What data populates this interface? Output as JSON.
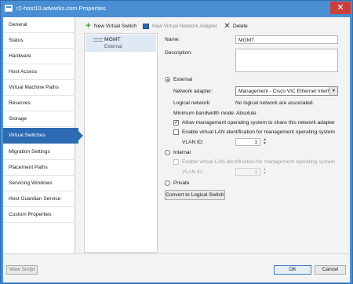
{
  "window": {
    "title": "r2-host10.advwrks.com Properties",
    "close_glyph": "✕"
  },
  "nav": {
    "items": [
      {
        "label": "General"
      },
      {
        "label": "Status"
      },
      {
        "label": "Hardware"
      },
      {
        "label": "Host Access"
      },
      {
        "label": "Virtual Machine Paths"
      },
      {
        "label": "Reserves"
      },
      {
        "label": "Storage"
      },
      {
        "label": "Virtual Switches",
        "selected": true
      },
      {
        "label": "Migration Settings"
      },
      {
        "label": "Placement Paths"
      },
      {
        "label": "Servicing Windows"
      },
      {
        "label": "Host Guardian Service"
      },
      {
        "label": "Custom Properties"
      }
    ]
  },
  "toolbar": {
    "new_switch_label": "New Virtual Switch",
    "new_switch_icon": "plus-icon",
    "new_adapter_label": "New Virtual Network Adapter",
    "new_adapter_icon": "network-adapter-icon",
    "delete_label": "Delete",
    "delete_icon": "x-icon"
  },
  "switch_list": {
    "items": [
      {
        "name": "MGMT",
        "type": "External"
      }
    ]
  },
  "details": {
    "name_label": "Name:",
    "name_value": "MGMT",
    "description_label": "Description:",
    "description_value": "",
    "external_label": "External",
    "network_adapter_label": "Network adapter:",
    "network_adapter_value": "Management - Cisco VIC Ethernet Interfa",
    "logical_network_label": "Logical network:",
    "logical_network_value": "No logical network are associated.",
    "min_bandwidth_label": "Minimum bandwidth mode:",
    "min_bandwidth_value": "Absolute",
    "allow_mgmt_label": "Allow management operating system to share this network adapter",
    "allow_mgmt_checked": true,
    "enable_vlan_label": "Enable virtual LAN identification for management operating system",
    "vlan_id_label": "VLAN ID:",
    "vlan_id_value": "1",
    "internal_label": "Internal",
    "internal_enable_vlan_label": "Enable virtual LAN identification for management operating system",
    "internal_vlan_id_label": "VLAN ID:",
    "internal_vlan_id_value": "1",
    "private_label": "Private",
    "convert_button_label": "Convert to Logical Switch",
    "selected_type": "External"
  },
  "footer": {
    "view_script_label": "View Script",
    "ok_label": "OK",
    "cancel_label": "Cancel"
  },
  "colors": {
    "title_bar": "#4a8fd4",
    "selected_nav": "#2d6bb3",
    "close_button": "#c9403a"
  }
}
